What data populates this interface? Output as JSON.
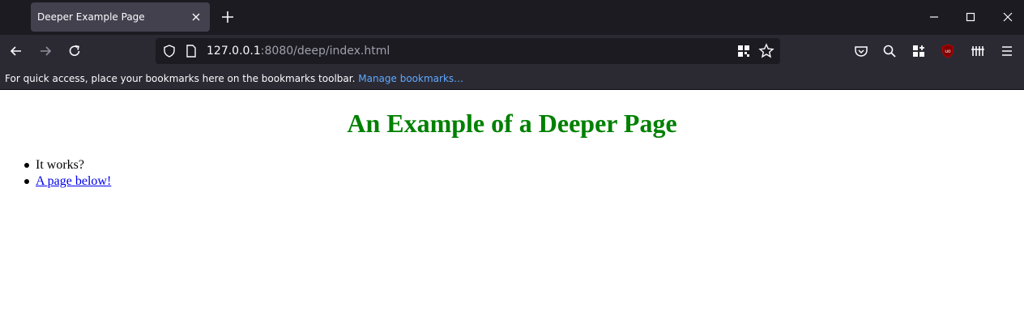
{
  "browser": {
    "tab": {
      "title": "Deeper Example Page"
    },
    "url": {
      "host": "127.0.0.1",
      "rest": ":8080/deep/index.html"
    },
    "bookmarks_bar": {
      "message": "For quick access, place your bookmarks here on the bookmarks toolbar.",
      "manage_link": "Manage bookmarks…"
    },
    "icons": {
      "tab_close": "close-icon",
      "new_tab": "plus-icon",
      "back": "arrow-left-icon",
      "forward": "arrow-right-icon",
      "reload": "reload-icon",
      "shield": "shield-icon",
      "page": "page-icon",
      "qr": "qr-code-icon",
      "star": "star-icon",
      "pocket": "pocket-icon",
      "search": "search-icon",
      "extensions": "extensions-icon",
      "ublock": "ublock-icon",
      "library": "library-icon",
      "menu": "hamburger-menu-icon"
    }
  },
  "page": {
    "heading": "An Example of a Deeper Page",
    "items": [
      {
        "text": "It works?",
        "is_link": false
      },
      {
        "text": "A page below!",
        "is_link": true
      }
    ],
    "heading_color": "#008000",
    "link_color": "#0000ee"
  }
}
